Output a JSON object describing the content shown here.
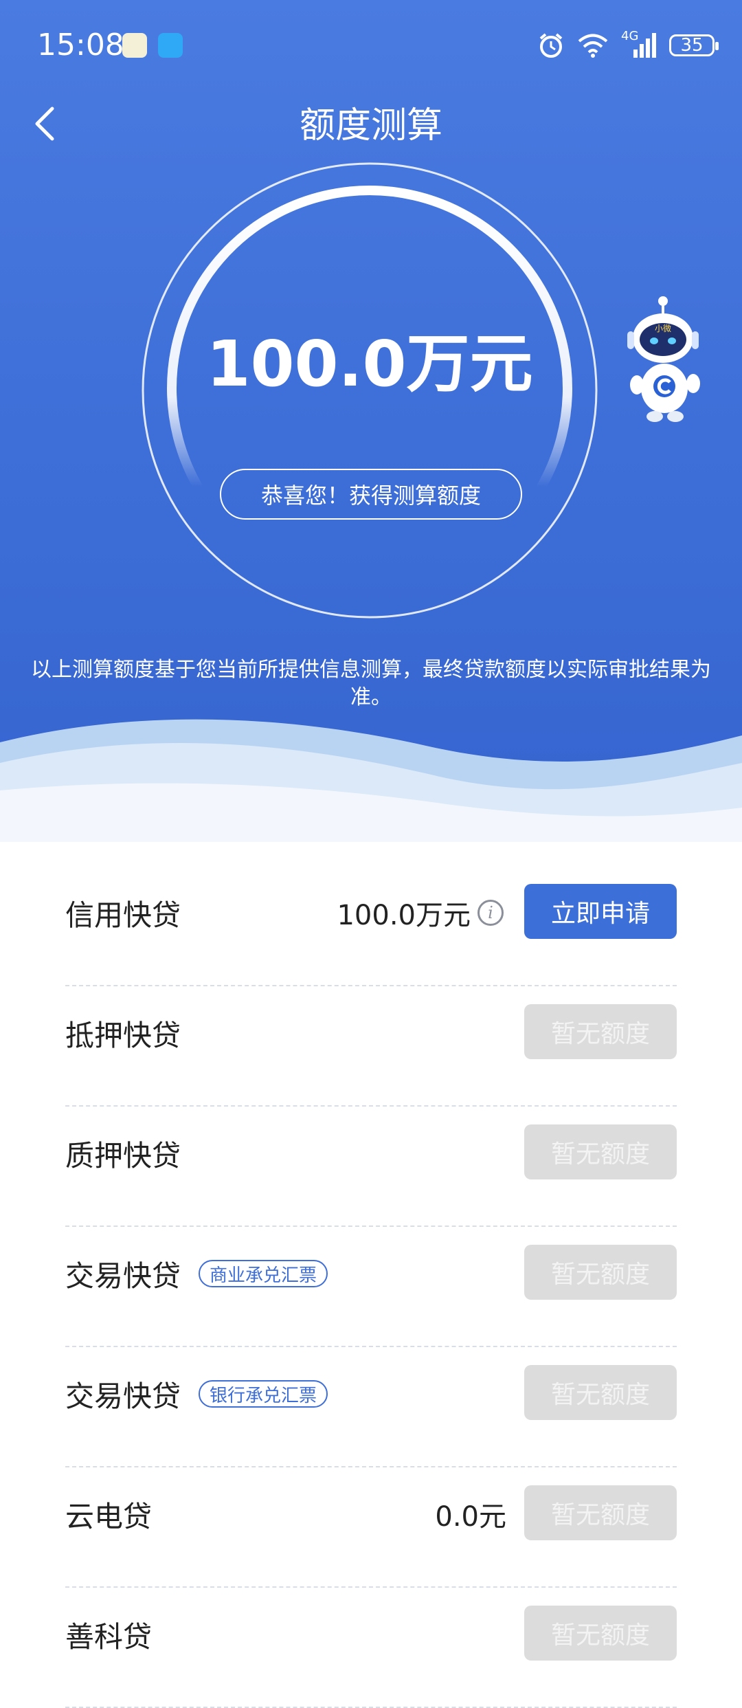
{
  "status_bar": {
    "time": "15:08",
    "battery": "35",
    "network": "4G"
  },
  "header": {
    "title": "额度测算"
  },
  "hero": {
    "amount": "100.0万元",
    "congrats": "恭喜您！获得测算额度",
    "mascot_label": "小微",
    "disclaimer": "以上测算额度基于您当前所提供信息测算，最终贷款额度以实际审批结果为准。"
  },
  "colors": {
    "primary": "#3d6fd9",
    "disabled": "#dcdcdc",
    "tag": "#3e6ed6"
  },
  "products": [
    {
      "name": "信用快贷",
      "tag": "",
      "value": "100.0万元",
      "info": true,
      "button": "立即申请",
      "enabled": true
    },
    {
      "name": "抵押快贷",
      "tag": "",
      "value": "",
      "info": false,
      "button": "暂无额度",
      "enabled": false
    },
    {
      "name": "质押快贷",
      "tag": "",
      "value": "",
      "info": false,
      "button": "暂无额度",
      "enabled": false
    },
    {
      "name": "交易快贷",
      "tag": "商业承兑汇票",
      "value": "",
      "info": false,
      "button": "暂无额度",
      "enabled": false
    },
    {
      "name": "交易快贷",
      "tag": "银行承兑汇票",
      "value": "",
      "info": false,
      "button": "暂无额度",
      "enabled": false
    },
    {
      "name": "云电贷",
      "tag": "",
      "value": "0.0元",
      "info": false,
      "button": "暂无额度",
      "enabled": false
    },
    {
      "name": "善科贷",
      "tag": "",
      "value": "",
      "info": false,
      "button": "暂无额度",
      "enabled": false
    }
  ]
}
